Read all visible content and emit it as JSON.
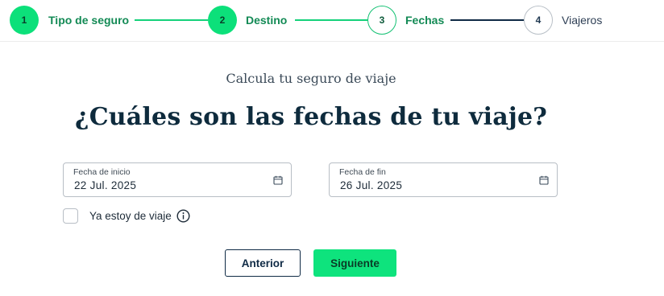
{
  "stepper": {
    "steps": [
      {
        "number": "1",
        "label": "Tipo de seguro",
        "state": "done"
      },
      {
        "number": "2",
        "label": "Destino",
        "state": "done"
      },
      {
        "number": "3",
        "label": "Fechas",
        "state": "current"
      },
      {
        "number": "4",
        "label": "Viajeros",
        "state": "pending"
      }
    ]
  },
  "header": {
    "kicker": "Calcula tu seguro de viaje",
    "title": "¿Cuáles son las fechas de tu viaje?"
  },
  "form": {
    "start_date": {
      "label": "Fecha de inicio",
      "value": "22 Jul. 2025",
      "icon": "calendar-icon"
    },
    "end_date": {
      "label": "Fecha de fin",
      "value": "26 Jul. 2025",
      "icon": "calendar-icon"
    },
    "already_traveling": {
      "label": "Ya estoy de viaje",
      "checked": false,
      "icon": "info-icon"
    }
  },
  "actions": {
    "prev_label": "Anterior",
    "next_label": "Siguiente"
  },
  "colors": {
    "accent": "#0ee37d",
    "dark": "#0f2a45"
  }
}
